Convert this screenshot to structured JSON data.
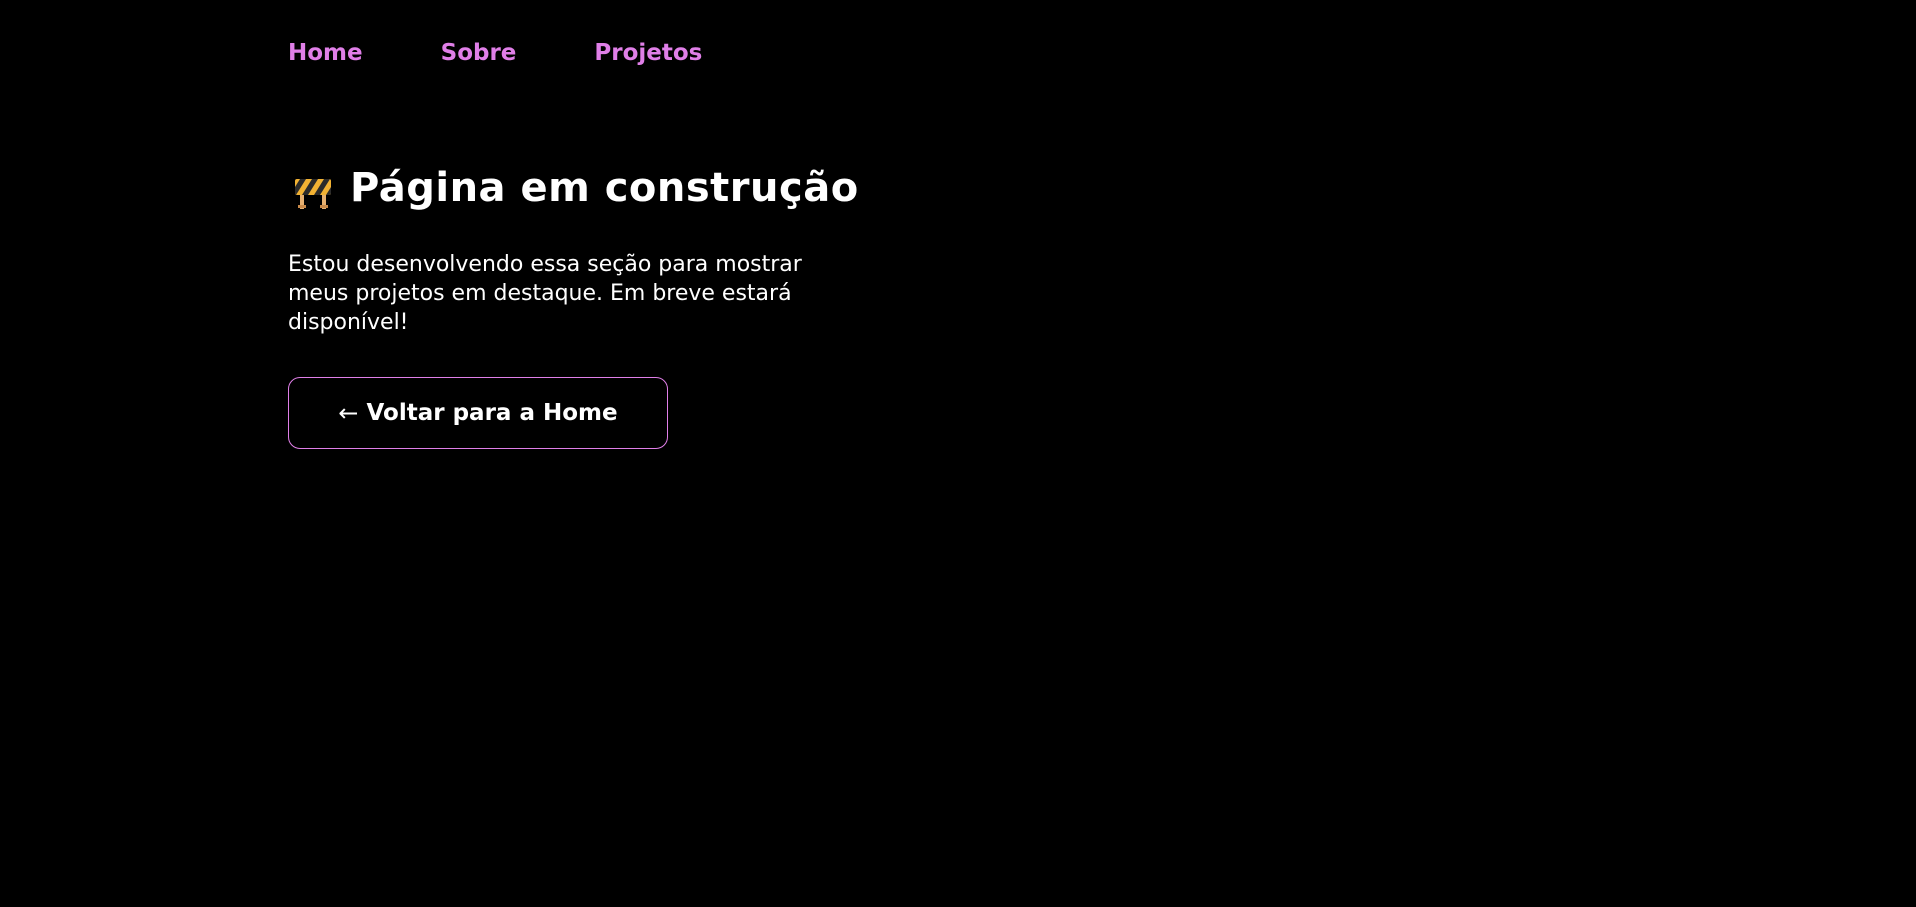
{
  "nav": {
    "items": [
      {
        "label": "Home"
      },
      {
        "label": "Sobre"
      },
      {
        "label": "Projetos"
      }
    ]
  },
  "main": {
    "title": "Página em construção",
    "title_icon": "construction-barrier-icon",
    "description": "Estou desenvolvendo essa seção para mostrar meus projetos em destaque. Em breve estará disponível!",
    "back_button": {
      "arrow": "←",
      "label": "Voltar para a Home"
    }
  },
  "colors": {
    "background": "#000000",
    "accent": "#e07fe8",
    "text": "#ffffff"
  }
}
